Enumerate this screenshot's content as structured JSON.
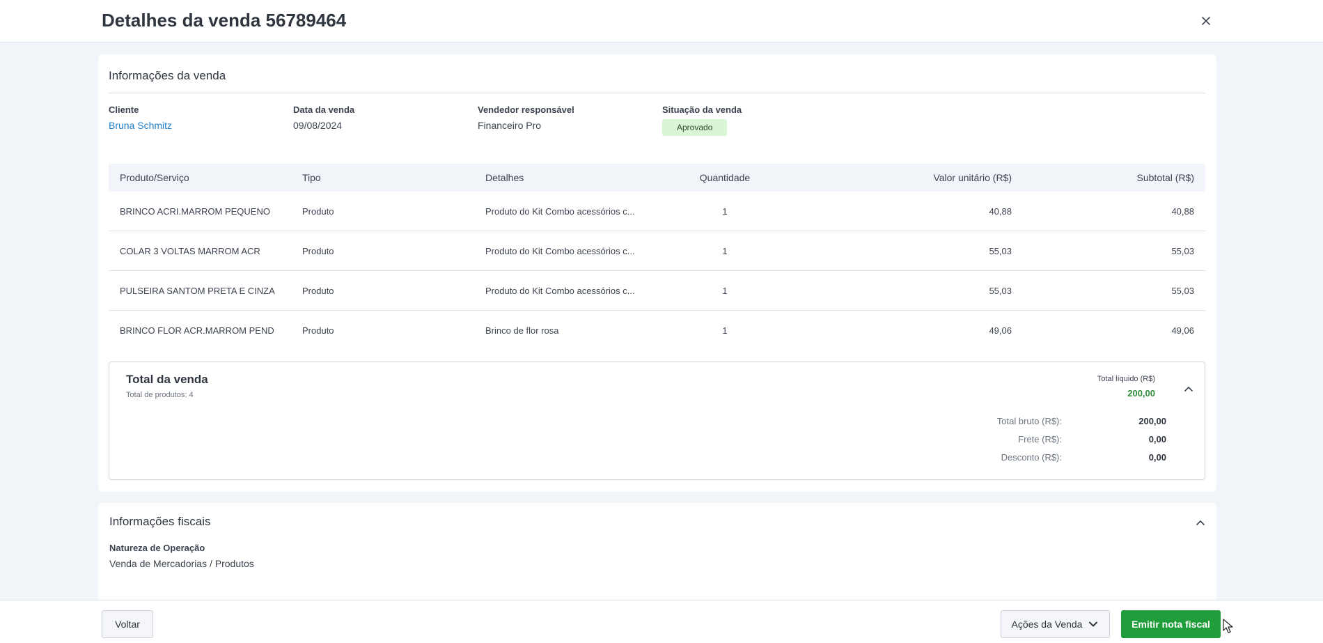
{
  "header": {
    "title": "Detalhes da venda 56789464"
  },
  "sale_info": {
    "title": "Informações da venda",
    "fields": [
      {
        "label": "Cliente",
        "value": "Bruna Schmitz"
      },
      {
        "label": "Data da venda",
        "value": "09/08/2024"
      },
      {
        "label": "Vendedor responsável",
        "value": "Financeiro Pro"
      },
      {
        "label": "Situação da venda",
        "value": "Aprovado"
      }
    ],
    "table": {
      "columns": [
        "Produto/Serviço",
        "Tipo",
        "Detalhes",
        "Quantidade",
        "Valor unitário (R$)",
        "Subtotal (R$)"
      ],
      "rows": [
        [
          "BRINCO ACRI.MARROM PEQUENO",
          "Produto",
          "Produto do Kit Combo acessórios c...",
          "1",
          "40,88",
          "40,88"
        ],
        [
          "COLAR 3 VOLTAS MARROM ACR",
          "Produto",
          "Produto do Kit Combo acessórios c...",
          "1",
          "55,03",
          "55,03"
        ],
        [
          "PULSEIRA SANTOM PRETA E CINZA",
          "Produto",
          "Produto do Kit Combo acessórios c...",
          "1",
          "55,03",
          "55,03"
        ],
        [
          "BRINCO FLOR ACR.MARROM PEND",
          "Produto",
          "Brinco de flor rosa",
          "1",
          "49,06",
          "49,06"
        ]
      ]
    },
    "totals": {
      "title": "Total da venda",
      "subtitle": "Total de produtos: 4",
      "net_label": "Total líquido (R$)",
      "net_value": "200,00",
      "rows": [
        {
          "label": "Total bruto (R$):",
          "value": "200,00"
        },
        {
          "label": "Frete (R$):",
          "value": "0,00"
        },
        {
          "label": "Desconto (R$):",
          "value": "0,00"
        }
      ]
    }
  },
  "fiscal": {
    "title": "Informações fiscais",
    "label": "Natureza de Operação",
    "value": "Venda de Mercadorias / Produtos"
  },
  "footer": {
    "back_label": "Voltar",
    "actions_label": "Ações da Venda",
    "emit_label": "Emitir nota fiscal"
  },
  "icons": {
    "close": "close-icon",
    "collapse": "chevron-up-icon",
    "dropdown": "chevron-down-icon",
    "cursor": "mouse-cursor-icon"
  },
  "colors": {
    "primary_button": "#1f9d3a",
    "link": "#1f7fc9",
    "net_total": "#2e8b3a",
    "status_badge_bg": "#d8f5d4"
  }
}
